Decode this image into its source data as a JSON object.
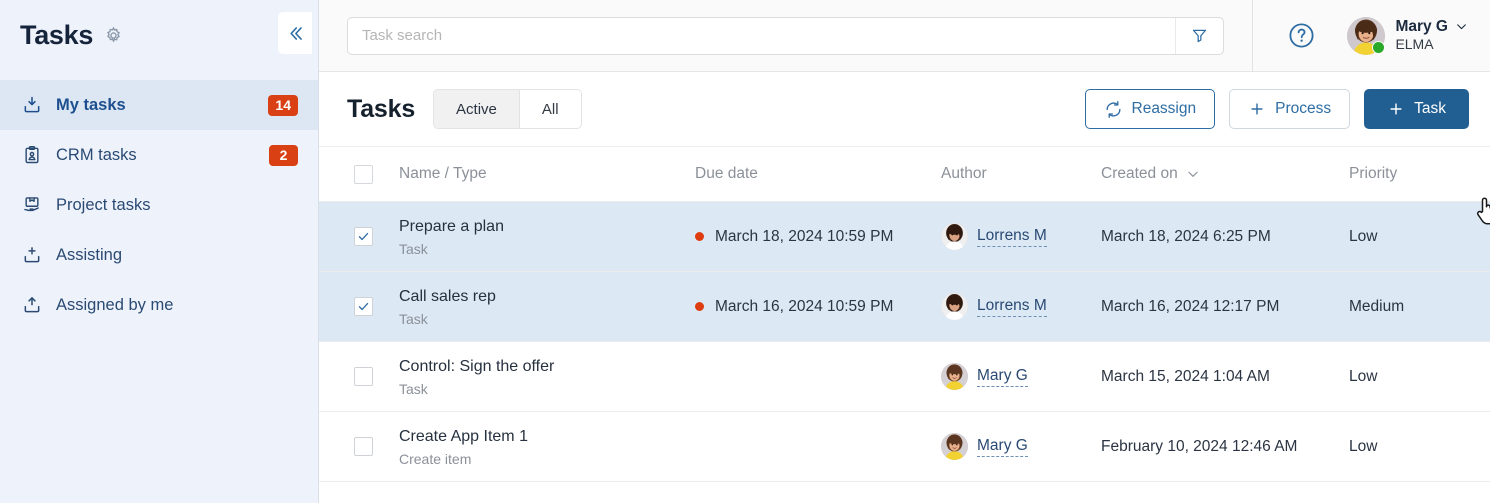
{
  "sidebar": {
    "title": "Tasks",
    "gear_icon": "gear-icon",
    "collapse_icon": "double-chevron-left-icon",
    "items": [
      {
        "label": "My tasks",
        "icon": "inbox-download-icon",
        "badge": "14",
        "active": true
      },
      {
        "label": "CRM tasks",
        "icon": "clipboard-person-icon",
        "badge": "2",
        "active": false
      },
      {
        "label": "Project tasks",
        "icon": "project-hand-icon",
        "badge": "",
        "active": false
      },
      {
        "label": "Assisting",
        "icon": "inbox-plus-icon",
        "badge": "",
        "active": false
      },
      {
        "label": "Assigned by me",
        "icon": "upload-tray-icon",
        "badge": "",
        "active": false
      }
    ]
  },
  "topbar": {
    "search": {
      "value": "",
      "placeholder": "Task search",
      "icon": "search-input"
    },
    "filter_icon": "funnel-filter-icon",
    "help_icon": "question-circle-icon",
    "user": {
      "name": "Mary G",
      "org": "ELMA",
      "status": "online",
      "avatar_icon": "user-avatar",
      "chevron_icon": "chevron-down-icon"
    }
  },
  "toolbar": {
    "title": "Tasks",
    "segments": [
      {
        "label": "Active",
        "selected": true
      },
      {
        "label": "All",
        "selected": false
      }
    ],
    "reassign_label": "Reassign",
    "reassign_icon": "refresh-sync-icon",
    "process_label": "Process",
    "process_icon": "plus-icon",
    "task_label": "Task",
    "task_icon": "plus-icon"
  },
  "table": {
    "columns": [
      {
        "label": "Name / Type",
        "sortable": false
      },
      {
        "label": "Due date",
        "sortable": false
      },
      {
        "label": "Author",
        "sortable": false
      },
      {
        "label": "Created on",
        "sortable": true
      },
      {
        "label": "Priority",
        "sortable": false
      }
    ],
    "header_checkbox_checked": false,
    "rows": [
      {
        "checked": true,
        "selected": true,
        "name": "Prepare a plan",
        "type": "Task",
        "due_date": "March 18, 2024 10:59 PM",
        "due_overdue": true,
        "author": "Lorrens M",
        "created_on": "March 18, 2024 6:25 PM",
        "priority": "Low"
      },
      {
        "checked": true,
        "selected": true,
        "name": "Call sales rep",
        "type": "Task",
        "due_date": "March 16, 2024 10:59 PM",
        "due_overdue": true,
        "author": "Lorrens M",
        "created_on": "March 16, 2024 12:17 PM",
        "priority": "Medium"
      },
      {
        "checked": false,
        "selected": false,
        "name": "Control: Sign the offer",
        "type": "Task",
        "due_date": "",
        "due_overdue": false,
        "author": "Mary G",
        "created_on": "March 15, 2024 1:04 AM",
        "priority": "Low"
      },
      {
        "checked": false,
        "selected": false,
        "name": "Create App Item 1",
        "type": "Create item",
        "due_date": "",
        "due_overdue": false,
        "author": "Mary G",
        "created_on": "February 10, 2024 12:46 AM",
        "priority": "Low"
      }
    ]
  },
  "colors": {
    "accent": "#215f93",
    "link": "#2a4a73",
    "badge": "#d94115",
    "overdue_dot": "#de3c11",
    "row_selected": "#dce9f5",
    "sidebar_bg": "#eef3fb",
    "status_online": "#2aa82a"
  },
  "cursor": {
    "icon": "pointing-hand-cursor"
  }
}
